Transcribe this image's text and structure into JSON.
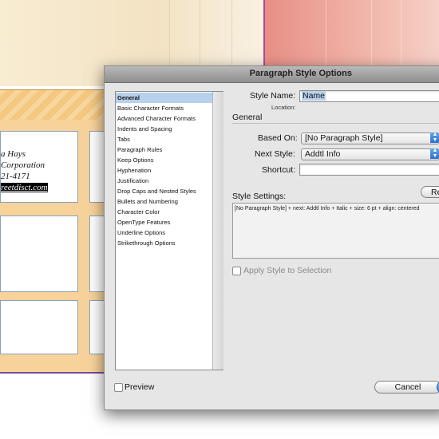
{
  "background": {
    "card": {
      "name": "a Hays",
      "company": "Corporation",
      "phone": "21-4171",
      "web": "reetdisct.com"
    }
  },
  "dialog": {
    "title": "Paragraph Style Options",
    "sidebar": {
      "items": [
        {
          "label": "General",
          "selected": true
        },
        {
          "label": "Basic Character Formats"
        },
        {
          "label": "Advanced Character Formats"
        },
        {
          "label": "Indents and Spacing"
        },
        {
          "label": "Tabs"
        },
        {
          "label": "Paragraph Rules"
        },
        {
          "label": "Keep Options"
        },
        {
          "label": "Hyphenation"
        },
        {
          "label": "Justification"
        },
        {
          "label": "Drop Caps and Nested Styles"
        },
        {
          "label": "Bullets and Numbering"
        },
        {
          "label": "Character Color"
        },
        {
          "label": "OpenType Features"
        },
        {
          "label": "Underline Options"
        },
        {
          "label": "Strikethrough Options"
        }
      ]
    },
    "style_name_label": "Style Name:",
    "style_name_value": "Name",
    "location_label": "Location:",
    "section_general": "General",
    "based_on_label": "Based On:",
    "based_on_value": "[No Paragraph Style]",
    "next_style_label": "Next Style:",
    "next_style_value": "Addtl Info",
    "shortcut_label": "Shortcut:",
    "shortcut_value": "",
    "reset_button_label": "Re",
    "style_settings_label": "Style Settings:",
    "style_settings_text": "[No Paragraph Style] + next: Addtl Info + Italic + size: 6 pt + align: centered",
    "apply_style_label": "Apply Style to Selection",
    "preview_label": "Preview",
    "cancel_button_label": "Cancel"
  }
}
